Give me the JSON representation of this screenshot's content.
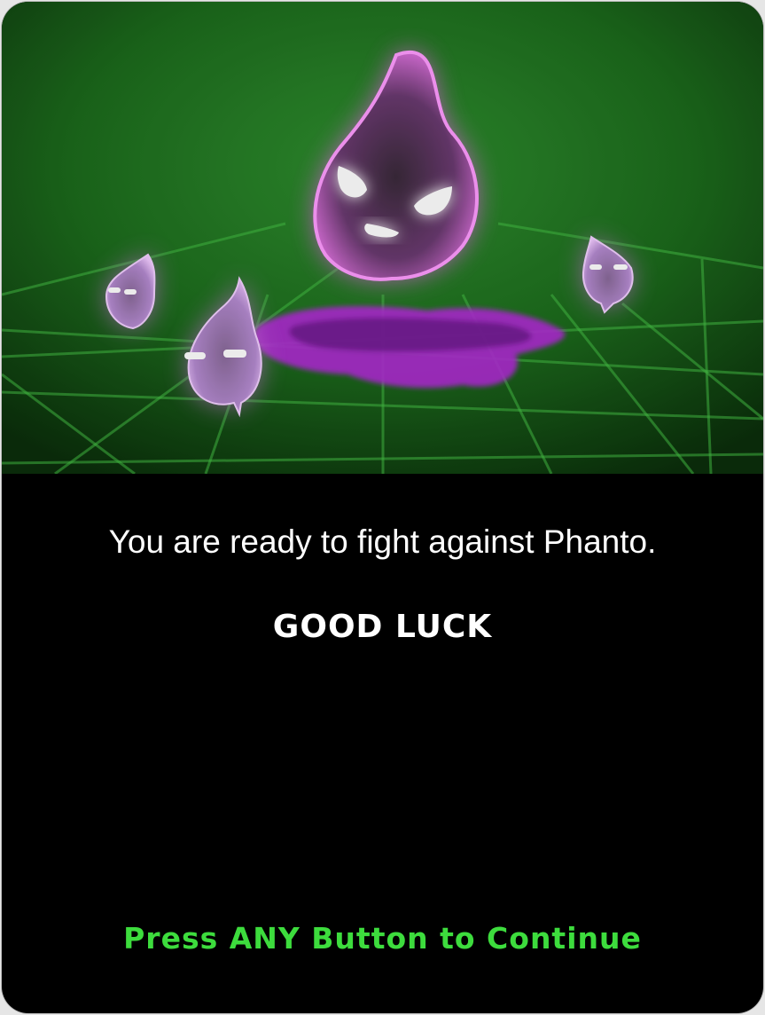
{
  "dialog": {
    "message": "You are ready to fight against Phanto.",
    "heading": "GOOD LUCK",
    "prompt": "Press ANY Button to Continue"
  },
  "illustration": {
    "subject": "Phanto ghost with three small ghost minions over a purple goo puddle on a green grid floor"
  },
  "colors": {
    "background": "#000000",
    "prompt_text": "#3ddc3d",
    "ghost_glow": "#d14ad6",
    "grid": "#3aa83a",
    "scene_green": "#1f7a1f"
  }
}
